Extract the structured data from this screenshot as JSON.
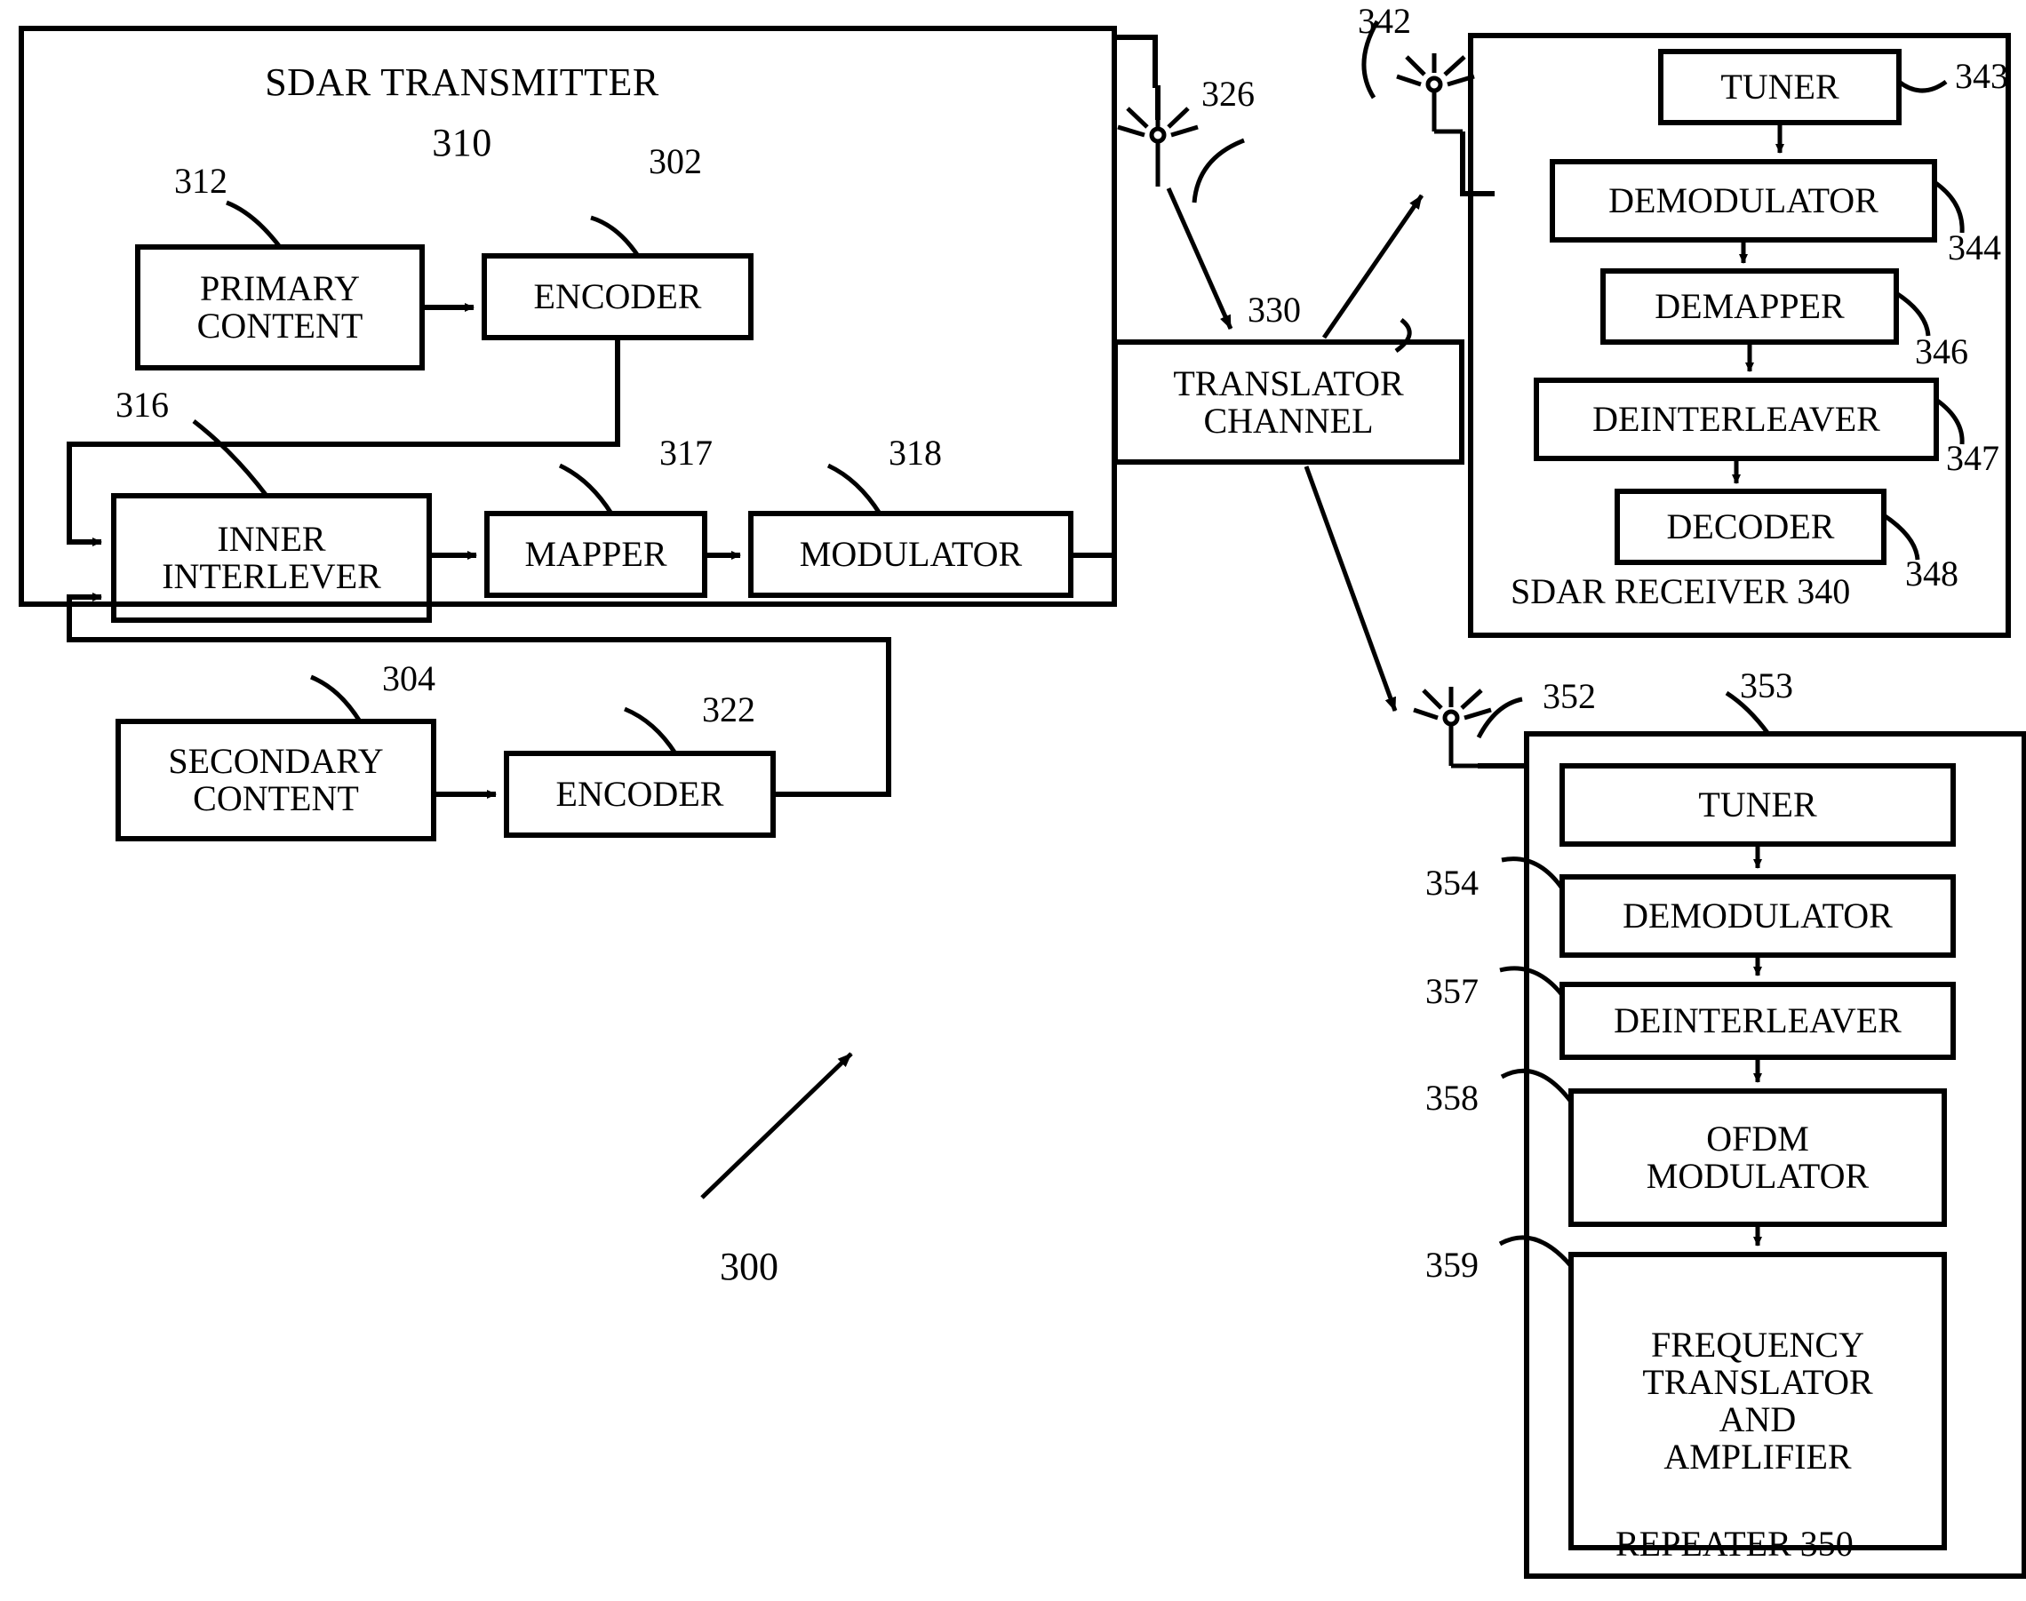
{
  "figure": {
    "number": "300",
    "type": "patent-block-diagram"
  },
  "transmitter": {
    "title": "SDAR TRANSMITTER",
    "ref": "310",
    "blocks": [
      {
        "id": "primary_content",
        "label": "PRIMARY\nCONTENT",
        "ref": "302"
      },
      {
        "id": "encoder_primary",
        "label": "ENCODER",
        "ref": "312"
      },
      {
        "id": "inner_interlever",
        "label": "INNER\nINTERLEVER",
        "ref": "316"
      },
      {
        "id": "mapper",
        "label": "MAPPER",
        "ref": "317"
      },
      {
        "id": "modulator",
        "label": "MODULATOR",
        "ref": "318"
      },
      {
        "id": "secondary_content",
        "label": "SECONDARY\nCONTENT",
        "ref": "304"
      },
      {
        "id": "encoder_secondary",
        "label": "ENCODER",
        "ref": "322"
      }
    ]
  },
  "antennas": [
    {
      "id": "transmitter_antenna",
      "ref": "326"
    },
    {
      "id": "receiver_antenna",
      "ref": "342"
    },
    {
      "id": "repeater_antenna",
      "ref": "352"
    }
  ],
  "translator": {
    "label": "TRANSLATOR\nCHANNEL",
    "ref": "330"
  },
  "receiver": {
    "title": "SDAR RECEIVER 340",
    "ref": "340",
    "blocks": [
      {
        "id": "tuner",
        "label": "TUNER",
        "ref": "343"
      },
      {
        "id": "demodulator",
        "label": "DEMODULATOR",
        "ref": "344"
      },
      {
        "id": "demapper",
        "label": "DEMAPPER",
        "ref": "346"
      },
      {
        "id": "deinterleaver",
        "label": "DEINTERLEAVER",
        "ref": "347"
      },
      {
        "id": "decoder",
        "label": "DECODER",
        "ref": "348"
      }
    ]
  },
  "repeater": {
    "title": "REPEATER 350",
    "ref": "350",
    "blocks": [
      {
        "id": "tuner",
        "label": "TUNER",
        "ref": "353"
      },
      {
        "id": "demodulator",
        "label": "DEMODULATOR",
        "ref": "354"
      },
      {
        "id": "deinterleaver",
        "label": "DEINTERLEAVER",
        "ref": "357"
      },
      {
        "id": "ofdm_modulator",
        "label": "OFDM\nMODULATOR",
        "ref": "358"
      },
      {
        "id": "frequency_translator",
        "label": "FREQUENCY\nTRANSLATOR\nAND\nAMPLIFIER",
        "ref": "359"
      }
    ]
  },
  "colors": {
    "ink": "#000000",
    "paper": "#ffffff"
  }
}
